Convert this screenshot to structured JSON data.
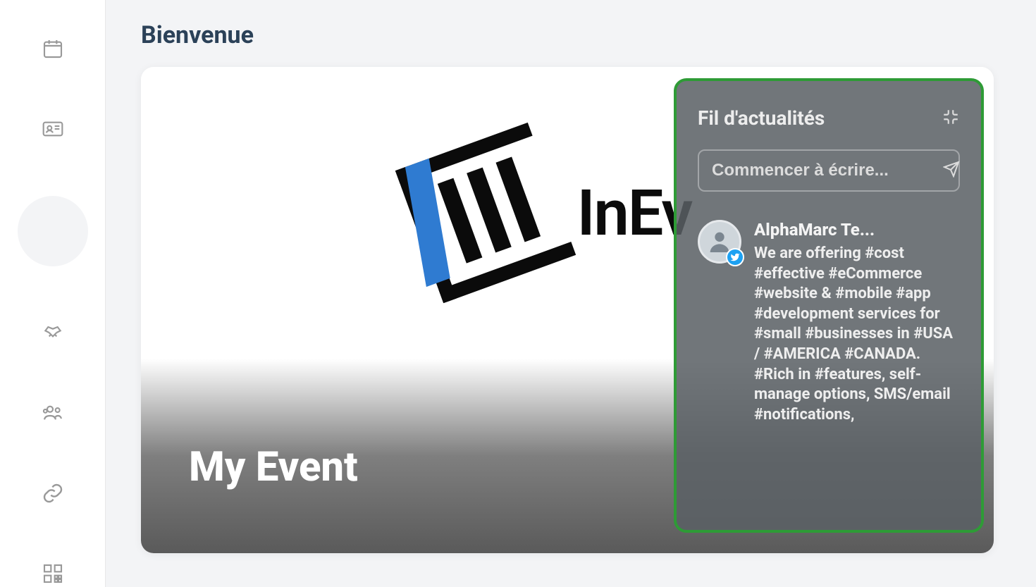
{
  "page": {
    "title": "Bienvenue"
  },
  "event": {
    "title": "My Event",
    "brand_text": "InEv"
  },
  "sidebar": {
    "items": [
      {
        "name": "calendar"
      },
      {
        "name": "id-card"
      },
      {
        "name": "monitor"
      },
      {
        "name": "handshake"
      },
      {
        "name": "group"
      },
      {
        "name": "link"
      },
      {
        "name": "qr-code"
      }
    ],
    "active_index": 2
  },
  "news": {
    "title": "Fil d'actualités",
    "compose_placeholder": "Commencer à écrire...",
    "posts": [
      {
        "author": "AlphaMarc Te...",
        "source": "twitter",
        "text": "We are offering #cost #effective #eCommerce #website & #mobile #app #development services for #small #businesses in #USA / #AMERICA #CANADA. #Rich in #features, self-manage options, SMS/email #notifications,"
      }
    ]
  },
  "colors": {
    "highlight_border": "#2e9b36",
    "accent_blue": "#2f7bd1",
    "twitter": "#1DA1F2"
  }
}
